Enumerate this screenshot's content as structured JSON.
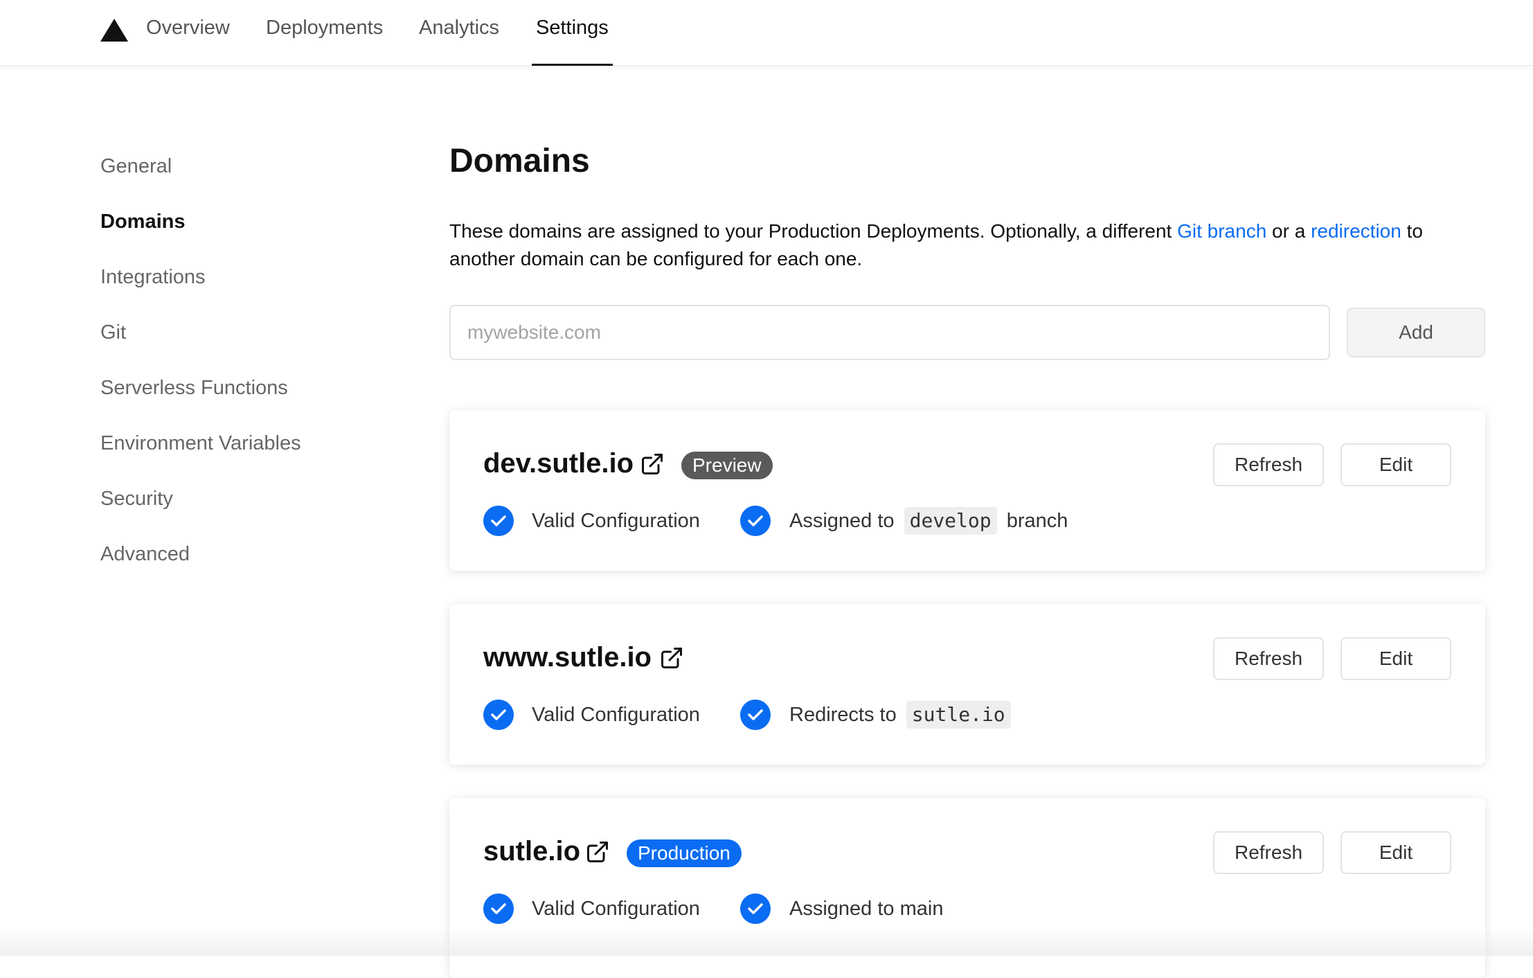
{
  "nav": {
    "tabs": [
      {
        "label": "Overview",
        "active": false
      },
      {
        "label": "Deployments",
        "active": false
      },
      {
        "label": "Analytics",
        "active": false
      },
      {
        "label": "Settings",
        "active": true
      }
    ]
  },
  "sidebar": {
    "items": [
      {
        "label": "General",
        "active": false
      },
      {
        "label": "Domains",
        "active": true
      },
      {
        "label": "Integrations",
        "active": false
      },
      {
        "label": "Git",
        "active": false
      },
      {
        "label": "Serverless Functions",
        "active": false
      },
      {
        "label": "Environment Variables",
        "active": false
      },
      {
        "label": "Security",
        "active": false
      },
      {
        "label": "Advanced",
        "active": false
      }
    ]
  },
  "main": {
    "title": "Domains",
    "description": {
      "part1": "These domains are assigned to your Production Deployments. Optionally, a different ",
      "link1": "Git branch",
      "part2": " or a ",
      "link2": "redirection",
      "part3": " to another domain can be configured for each one."
    },
    "input": {
      "placeholder": "mywebsite.com",
      "value": ""
    },
    "add_label": "Add"
  },
  "domains": [
    {
      "name": "dev.sutle.io",
      "badge": "Preview",
      "refresh_label": "Refresh",
      "edit_label": "Edit",
      "config_status": "Valid Configuration",
      "assignment_prefix": "Assigned to",
      "assignment_code": "develop",
      "assignment_suffix": "branch"
    },
    {
      "name": "www.sutle.io",
      "badge": "",
      "refresh_label": "Refresh",
      "edit_label": "Edit",
      "config_status": "Valid Configuration",
      "assignment_prefix": "Redirects to",
      "assignment_code": "sutle.io",
      "assignment_suffix": ""
    },
    {
      "name": "sutle.io",
      "badge": "Production",
      "refresh_label": "Refresh",
      "edit_label": "Edit",
      "config_status": "Valid Configuration",
      "assignment_prefix": "Assigned to main",
      "assignment_code": "",
      "assignment_suffix": ""
    }
  ],
  "colors": {
    "accent": "#0a6cf2",
    "check": "#0a6cf2",
    "preview_badge": "#5a5a5a",
    "production_badge": "#0a6cf2"
  },
  "icons": {
    "logo": "triangle-logo-icon",
    "external": "external-link-icon",
    "check": "check-circle-icon"
  }
}
